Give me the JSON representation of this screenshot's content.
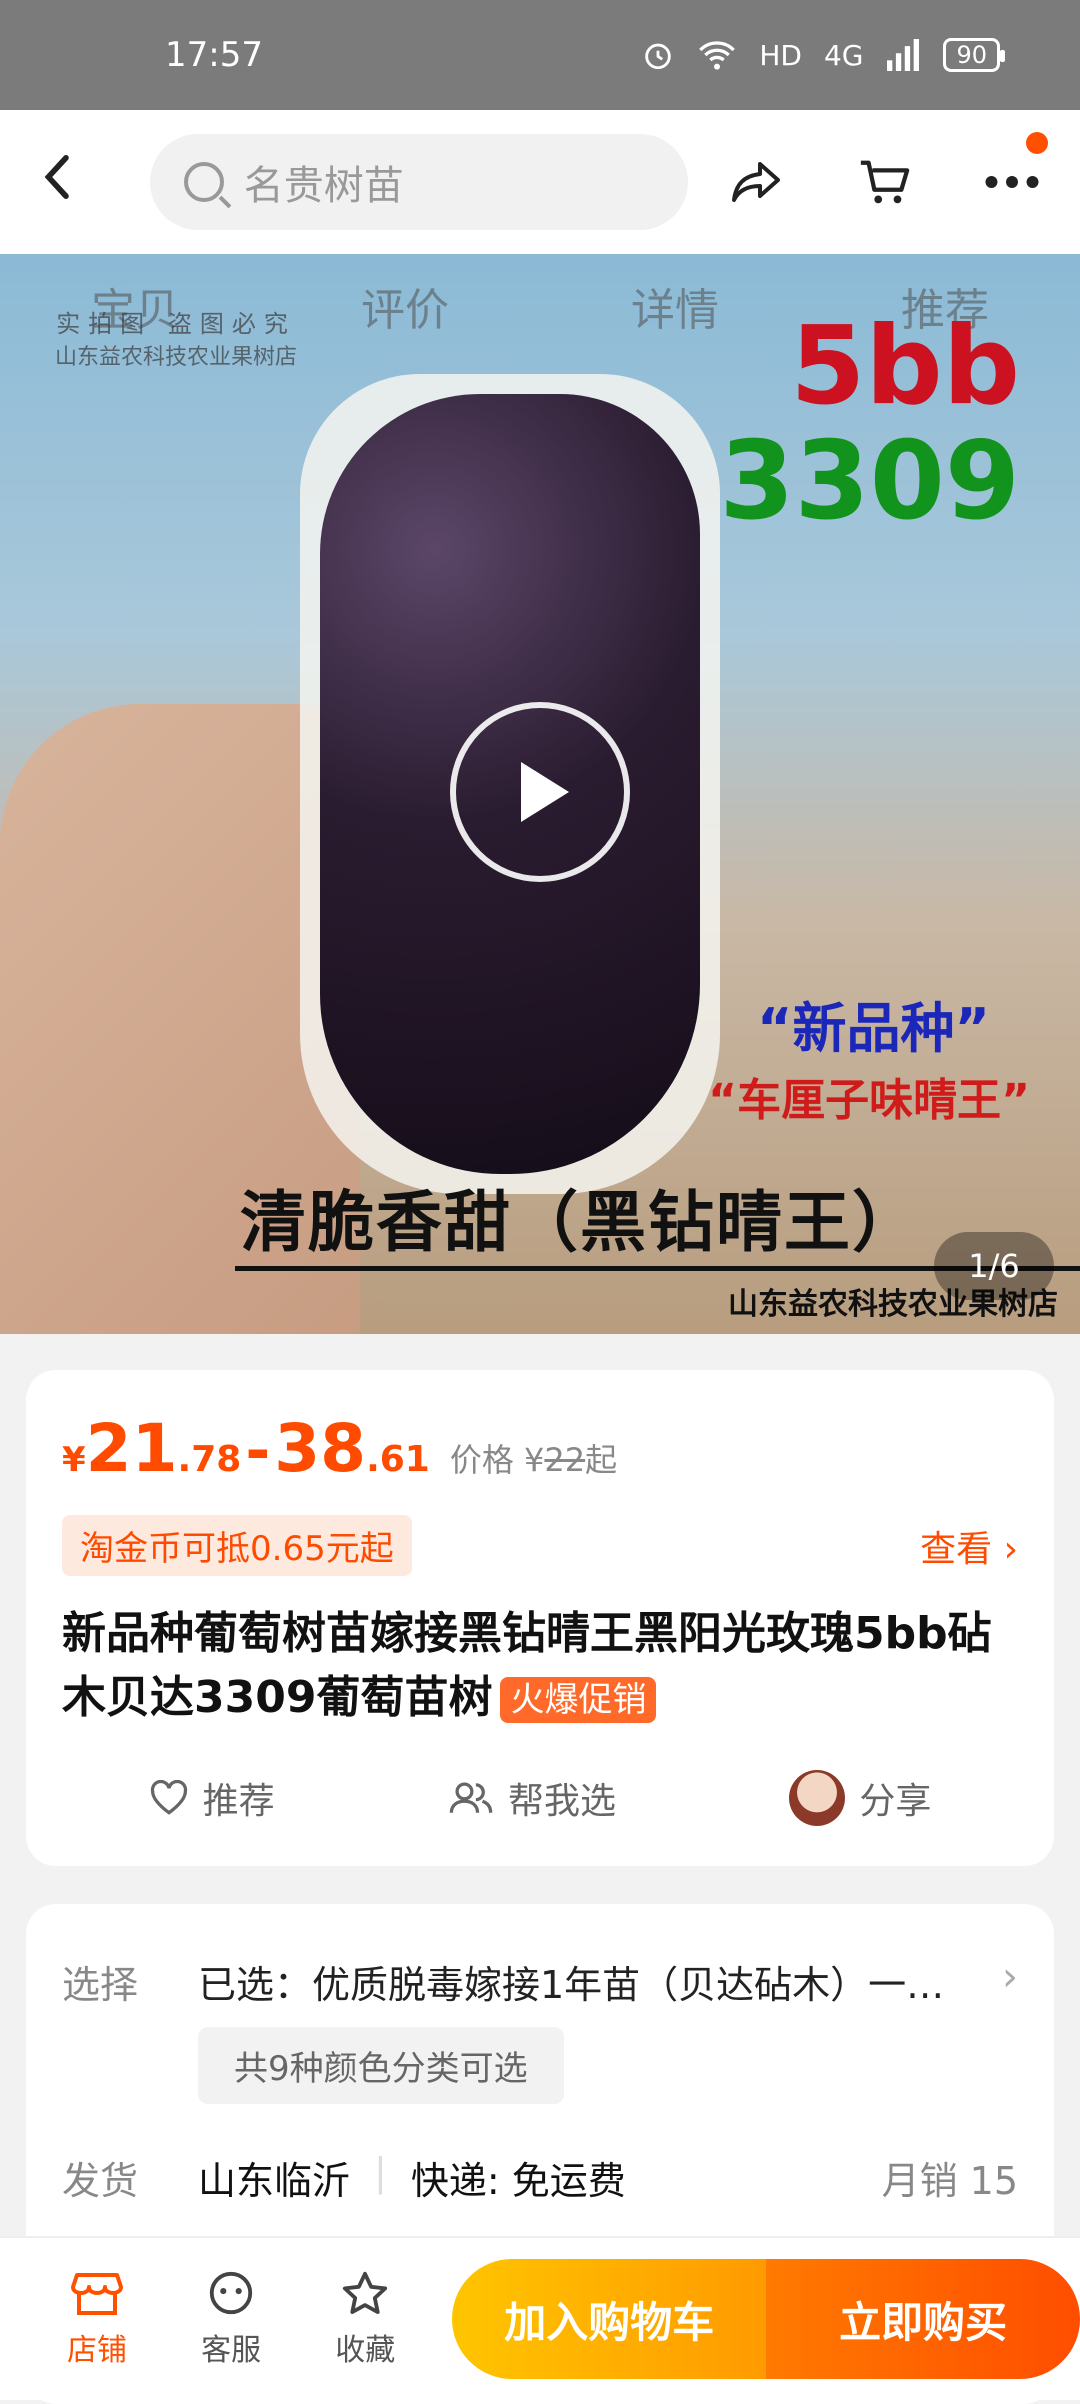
{
  "status": {
    "time": "17:57",
    "hd": "HD",
    "signal": "4G",
    "battery": "90"
  },
  "header": {
    "search_placeholder": "名贵树苗"
  },
  "hero": {
    "tabs": [
      "宝贝",
      "评价",
      "详情",
      "推荐"
    ],
    "watermark_line1": "实拍图 盗图必究",
    "watermark_line2": "山东益农科技农业果树店",
    "label_5bb": "5bb",
    "label_3309": "3309",
    "new_variety": "“新品种”",
    "flavor": "“车厘子味晴王”",
    "caption": "清脆香甜（黑钻晴王）",
    "shop_name": "山东益农科技农业果树店",
    "counter": "1/6"
  },
  "product": {
    "currency": "¥",
    "price_low_int": "21",
    "price_low_dec": ".78",
    "dash": "-",
    "price_high_int": "38",
    "price_high_dec": ".61",
    "original_label": "价格 ¥",
    "original_value": "22",
    "original_suffix": "起",
    "coin_offer": "淘金币可抵0.65元起",
    "view_label": "查看 ›",
    "title": "新品种葡萄树苗嫁接黑钻晴王黑阳光玫瑰5bb砧木贝达3309葡萄苗树",
    "hot_badge": "火爆促销",
    "actions": {
      "recommend": "推荐",
      "help_choose": "帮我选",
      "share": "分享"
    }
  },
  "details": {
    "select_label": "选择",
    "select_value": "已选：优质脱毒嫁接1年苗（贝达砧木）一…",
    "options_chip": "共9种颜色分类可选",
    "ship_label": "发货",
    "ship_from": "山东临沂",
    "ship_method": "快递: 免运费",
    "monthly_sales": "月销 15"
  },
  "bottom": {
    "shop": "店铺",
    "service": "客服",
    "favorite": "收藏",
    "add_cart": "加入购物车",
    "buy_now": "立即购买"
  },
  "colors": {
    "accent": "#ff5000",
    "cart_gradient": "#ffc500",
    "buy_gradient": "#ff4d00"
  }
}
